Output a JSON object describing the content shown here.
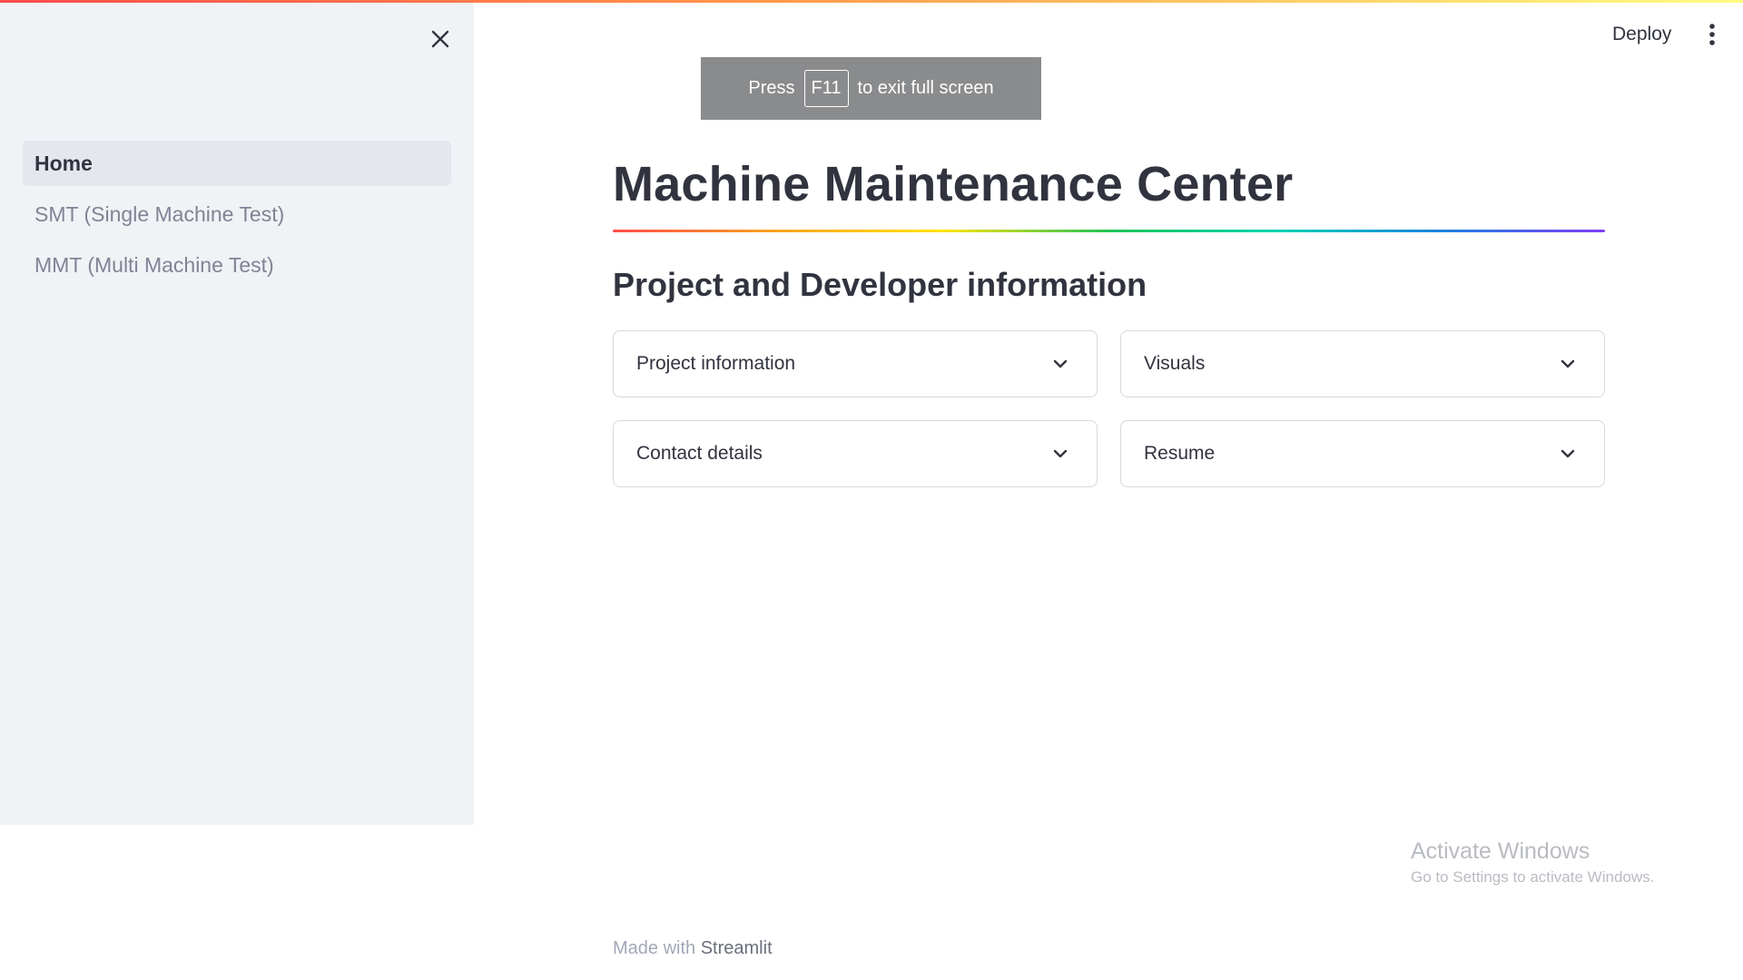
{
  "sidebar": {
    "items": [
      {
        "label": "Home",
        "active": true
      },
      {
        "label": "SMT (Single Machine Test)",
        "active": false
      },
      {
        "label": "MMT (Multi Machine Test)",
        "active": false
      }
    ]
  },
  "header": {
    "deploy_label": "Deploy"
  },
  "fullscreen_toast": {
    "press": "Press",
    "key": "F11",
    "rest": "to exit full screen"
  },
  "main": {
    "title": "Machine Maintenance Center",
    "section_heading": "Project and Developer information",
    "expanders": [
      {
        "label": "Project information"
      },
      {
        "label": "Visuals"
      },
      {
        "label": "Contact details"
      },
      {
        "label": "Resume"
      }
    ]
  },
  "footer": {
    "made_with": "Made with",
    "brand": "Streamlit"
  },
  "watermark": {
    "title": "Activate Windows",
    "subtitle": "Go to Settings to activate Windows."
  },
  "colors": {
    "sidebar_bg": "#f0f2f6",
    "text": "#31333f",
    "accent": "#ff4b4b"
  }
}
